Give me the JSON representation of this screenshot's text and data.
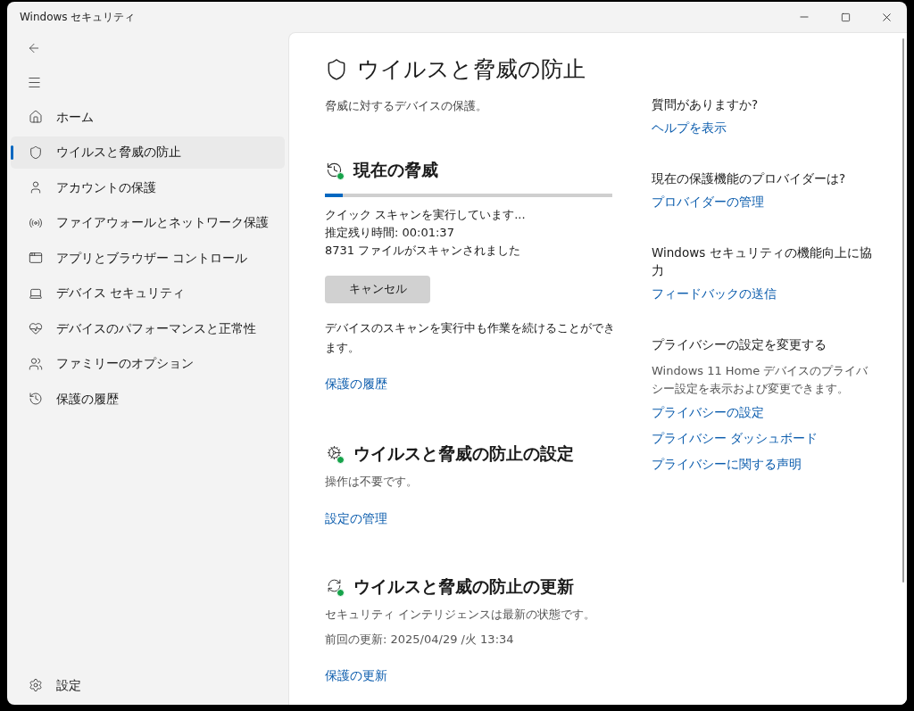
{
  "window": {
    "title": "Windows セキュリティ"
  },
  "sidebar": {
    "items": [
      {
        "label": "ホーム",
        "selected": false
      },
      {
        "label": "ウイルスと脅威の防止",
        "selected": true
      },
      {
        "label": "アカウントの保護",
        "selected": false
      },
      {
        "label": "ファイアウォールとネットワーク保護",
        "selected": false
      },
      {
        "label": "アプリとブラウザー コントロール",
        "selected": false
      },
      {
        "label": "デバイス セキュリティ",
        "selected": false
      },
      {
        "label": "デバイスのパフォーマンスと正常性",
        "selected": false
      },
      {
        "label": "ファミリーのオプション",
        "selected": false
      },
      {
        "label": "保護の履歴",
        "selected": false
      }
    ],
    "footer_item": {
      "label": "設定"
    }
  },
  "page": {
    "title": "ウイルスと脅威の防止",
    "subtitle": "脅威に対するデバイスの保護。"
  },
  "current_threats": {
    "title": "現在の脅威",
    "level": 0.062,
    "status_lines": [
      "クイック スキャンを実行しています...",
      "推定残り時間: 00:01:37",
      "8731 ファイルがスキャンされました"
    ],
    "button": "キャンセル",
    "note": "デバイスのスキャンを実行中も作業を続けることができます。",
    "link": "保護の履歴"
  },
  "settings": {
    "title": "ウイルスと脅威の防止の設定",
    "status": "操作は不要です。",
    "link": "設定の管理"
  },
  "updates": {
    "title": "ウイルスと脅威の防止の更新",
    "status": "セキュリティ インテリジェンスは最新の状態です。",
    "last_update": "前回の更新: 2025/04/29 /火 13:34",
    "link": "保護の更新"
  },
  "side_panel": [
    {
      "heading": "質問がありますか?",
      "links": [
        "ヘルプを表示"
      ]
    },
    {
      "heading": "現在の保護機能のプロバイダーは?",
      "links": [
        "プロバイダーの管理"
      ]
    },
    {
      "heading": "Windows セキュリティの機能向上に協力",
      "links": [
        "フィードバックの送信"
      ]
    },
    {
      "heading": "プライバシーの設定を変更する",
      "description": "Windows 11 Home デバイスのプライバシー設定を表示および変更できます。",
      "links": [
        "プライバシーの設定",
        "プライバシー ダッシュボード",
        "プライバシーに関する声明"
      ]
    }
  ]
}
